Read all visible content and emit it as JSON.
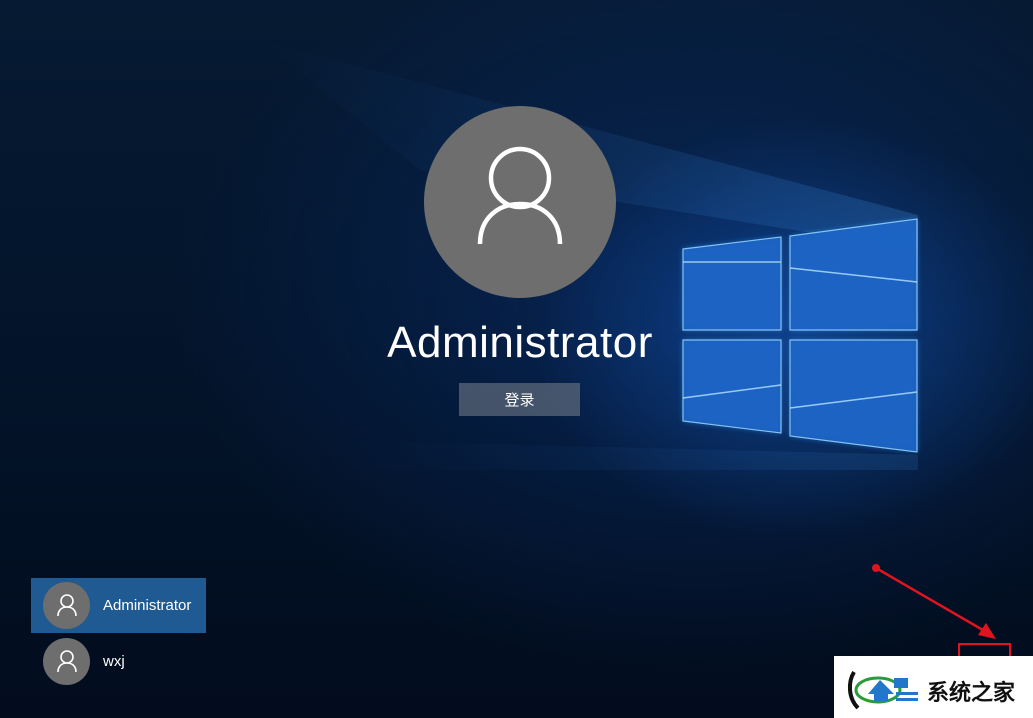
{
  "main": {
    "username": "Administrator",
    "signin_label": "登录"
  },
  "user_list": [
    {
      "name": "Administrator",
      "selected": true
    },
    {
      "name": "wxj",
      "selected": false
    }
  ],
  "annotation": {
    "color": "#e0141e"
  },
  "watermark": {
    "text": "系统之家"
  },
  "colors": {
    "avatar_gray": "#6e6e6e",
    "selected_tile": "#1f5a93",
    "windows_glow": "#3aa0ff"
  }
}
